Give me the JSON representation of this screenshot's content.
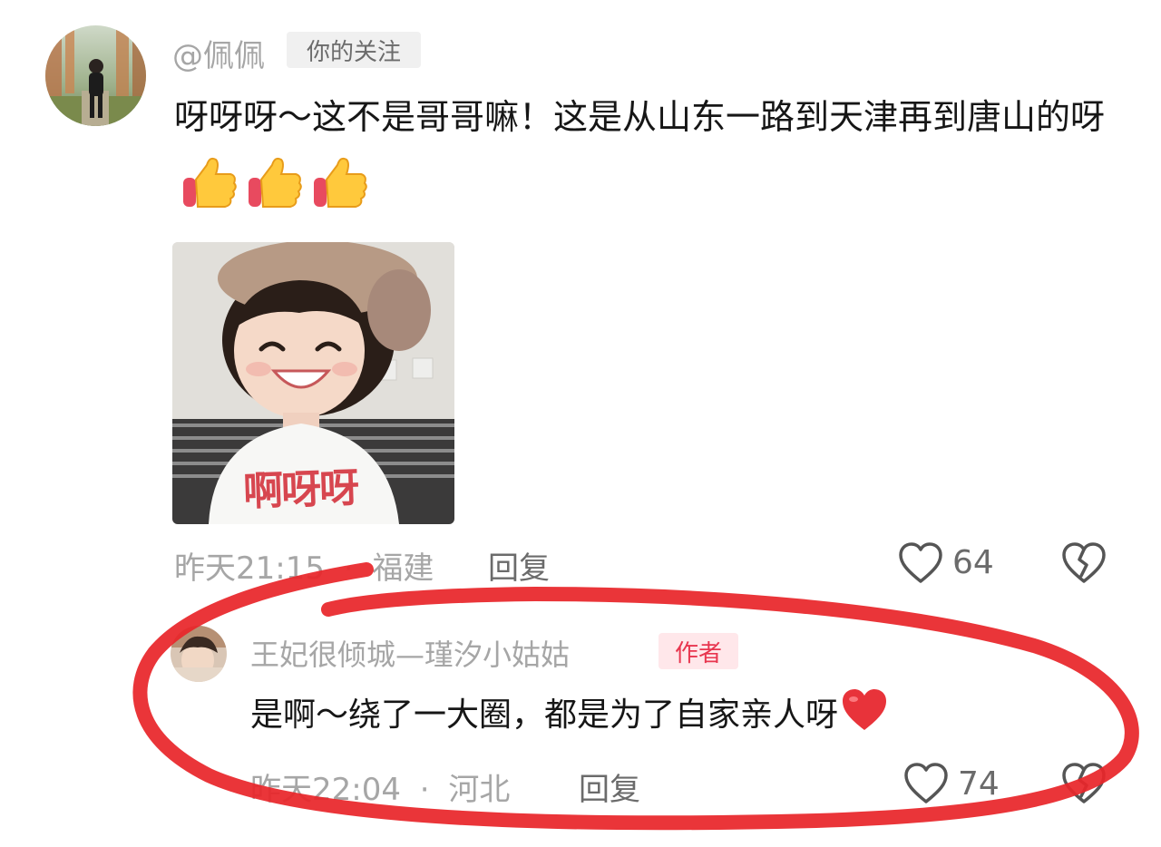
{
  "comments": [
    {
      "username": "@佩佩",
      "tag": "你的关注",
      "text": "呀呀呀～这不是哥哥嘛！这是从山东一路到天津再到唐山的呀",
      "emojis": [
        "thumbs-up",
        "thumbs-up",
        "thumbs-up"
      ],
      "sticker": {
        "caption": "啊呀呀"
      },
      "time": "昨天21:15",
      "location": "福建",
      "reply_label": "回复",
      "likes": "64"
    },
    {
      "username": "王妃很倾城—瑾汐小姑姑",
      "tag": "作者",
      "text": "是啊～绕了一大圈，都是为了自家亲人呀",
      "emojis": [
        "red-heart"
      ],
      "time": "昨天22:04",
      "location": "河北",
      "reply_label": "回复",
      "likes": "74"
    }
  ],
  "separator": "·",
  "colors": {
    "meta_gray": "#a6a6a6",
    "author_tag": "#e8364f",
    "follow_tag_bg": "#f0f0f0",
    "annotation_red": "#e8262a"
  },
  "icons": [
    "heart-outline-icon",
    "broken-heart-icon"
  ]
}
